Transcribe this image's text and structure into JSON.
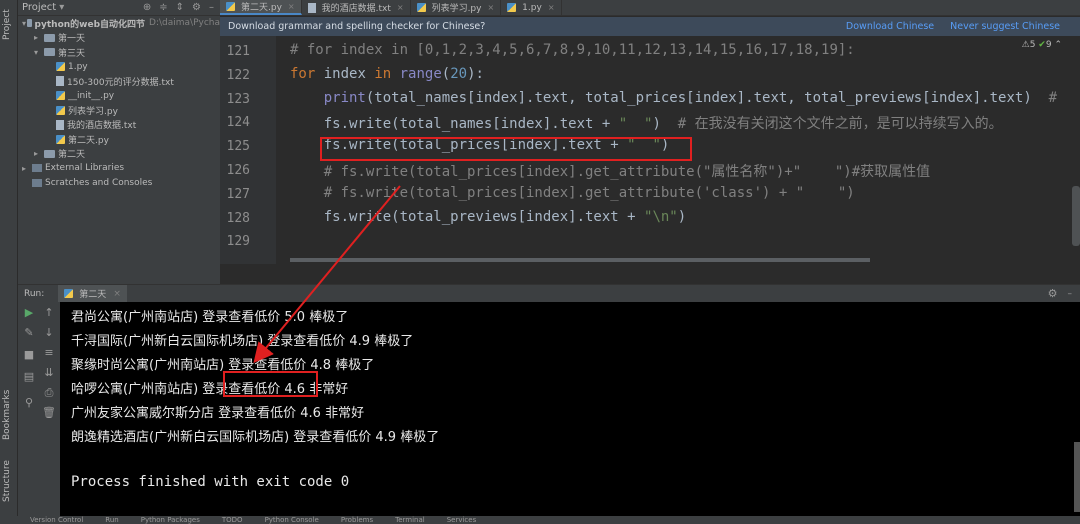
{
  "sidebar": {
    "project_label": "Project",
    "bookmarks_label": "Bookmarks",
    "structure_label": "Structure"
  },
  "project": {
    "header": "Project",
    "tree": [
      {
        "label": "python的web自动化四节",
        "path": "D:\\daima\\Pycha",
        "depth": 0,
        "kind": "folder",
        "expanded": true
      },
      {
        "label": "第一天",
        "depth": 1,
        "kind": "folder",
        "expanded": false
      },
      {
        "label": "第三天",
        "depth": 1,
        "kind": "folder",
        "expanded": true
      },
      {
        "label": "1.py",
        "depth": 2,
        "kind": "py"
      },
      {
        "label": "150-300元的评分数据.txt",
        "depth": 2,
        "kind": "txt"
      },
      {
        "label": "__init__.py",
        "depth": 2,
        "kind": "py"
      },
      {
        "label": "列表学习.py",
        "depth": 2,
        "kind": "py"
      },
      {
        "label": "我的酒店数据.txt",
        "depth": 2,
        "kind": "txt"
      },
      {
        "label": "第二天.py",
        "depth": 2,
        "kind": "py"
      },
      {
        "label": "第二天",
        "depth": 1,
        "kind": "folder",
        "expanded": false
      },
      {
        "label": "External Libraries",
        "depth": 0,
        "kind": "lib",
        "expanded": false
      },
      {
        "label": "Scratches and Consoles",
        "depth": 0,
        "kind": "lib"
      }
    ]
  },
  "tabs": [
    {
      "label": "第二天.py",
      "active": true
    },
    {
      "label": "我的酒店数据.txt",
      "active": false
    },
    {
      "label": "列表学习.py",
      "active": false
    },
    {
      "label": "1.py",
      "active": false
    }
  ],
  "banner": {
    "message": "Download grammar and spelling checker for Chinese?",
    "action_download": "Download Chinese",
    "action_never": "Never suggest Chinese"
  },
  "editor": {
    "warnings_count": "5",
    "ok_count": "9",
    "lines": [
      {
        "no": "121",
        "text": "# for index in [0,1,2,3,4,5,6,7,8,9,10,11,12,13,14,15,16,17,18,19]:"
      },
      {
        "no": "122",
        "text": "for index in range(20):"
      },
      {
        "no": "123",
        "text": "    print(total_names[index].text, total_prices[index].text, total_previews[index].text)  #"
      },
      {
        "no": "124",
        "text": "    fs.write(total_names[index].text + \"  \")  # 在我没有关闭这个文件之前，是可以持续写入的。"
      },
      {
        "no": "125",
        "text": "    fs.write(total_prices[index].text + \"  \")"
      },
      {
        "no": "126",
        "text": "    # fs.write(total_prices[index].get_attribute(\"属性名称\")+\"    \")#获取属性值"
      },
      {
        "no": "127",
        "text": "    # fs.write(total_prices[index].get_attribute('class') + \"    \")"
      },
      {
        "no": "128",
        "text": "    fs.write(total_previews[index].text + \"\\n\")"
      },
      {
        "no": "129",
        "text": ""
      }
    ]
  },
  "run": {
    "label": "Run:",
    "tab": "第二天",
    "output": [
      "君尚公寓(广州南站店) 登录查看低价 5.0 棒极了",
      "千浔国际(广州新白云国际机场店) 登录查看低价 4.9 棒极了",
      "聚缘时尚公寓(广州南站店) 登录查看低价 4.8 棒极了",
      "哈啰公寓(广州南站店) 登录查看低价 4.6 非常好",
      "广州友家公寓威尔斯分店 登录查看低价 4.6 非常好",
      "朗逸精选酒店(广州新白云国际机场店) 登录查看低价 4.9 棒极了",
      "",
      "Process finished with exit code 0"
    ]
  },
  "statusbar": [
    "Version Control",
    "Run",
    "Python Packages",
    "TODO",
    "Python Console",
    "Problems",
    "Terminal",
    "Services"
  ],
  "colors": {
    "annotation": "#e02020",
    "background": "#2b2b2b",
    "panel": "#3c3f41",
    "console_bg": "#000000"
  }
}
